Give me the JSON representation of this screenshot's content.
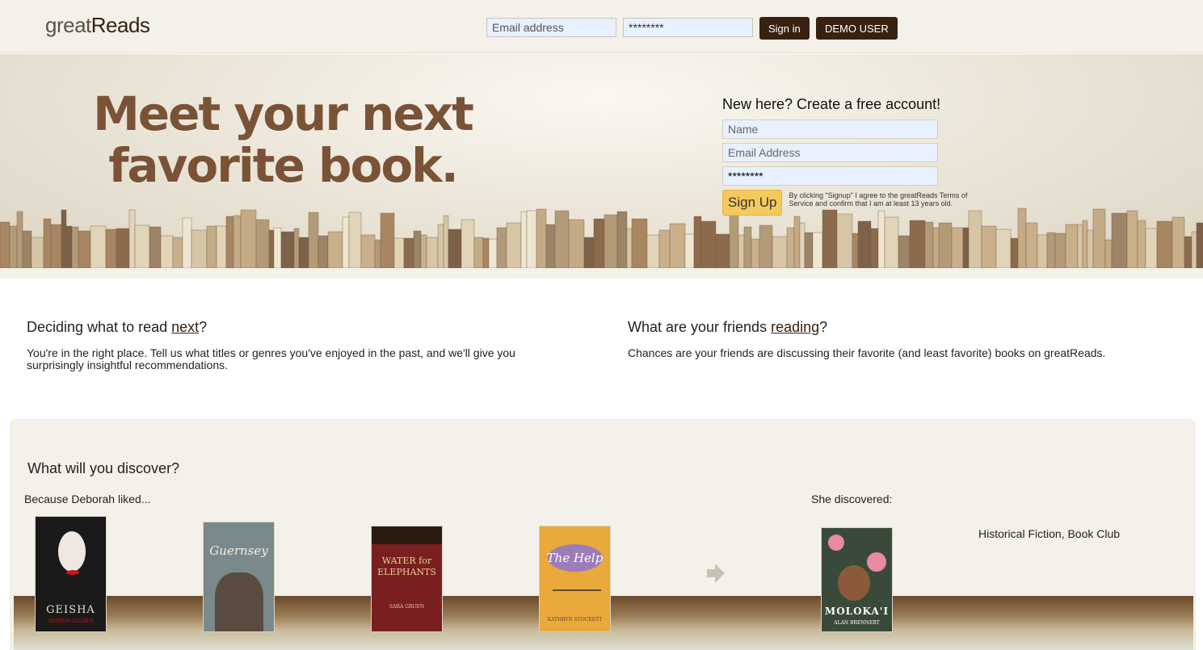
{
  "header": {
    "logo_light": "great",
    "logo_bold": "Reads",
    "email_placeholder": "Email address",
    "password_value": "********",
    "signin_label": "Sign in",
    "demo_label": "DEMO USER"
  },
  "hero": {
    "title_line1": "Meet your next",
    "title_line2": "favorite book.",
    "signup": {
      "heading": "New here? Create a free account!",
      "name_placeholder": "Name",
      "email_placeholder": "Email Address",
      "password_value": "********",
      "button_label": "Sign Up",
      "terms": "By clicking \"Signup\" I agree to the greatReads Terms of Service and confirm that I am at least 13 years old."
    }
  },
  "info": {
    "left": {
      "heading_prefix": "Deciding what to read ",
      "heading_link": "next",
      "heading_suffix": "?",
      "text": "You're in the right place. Tell us what titles or genres you've enjoyed in the past, and we'll give you surprisingly insightful recommendations."
    },
    "right": {
      "heading_prefix": "What are your friends ",
      "heading_link": "reading",
      "heading_suffix": "?",
      "text": "Chances are your friends are discussing their favorite (and least favorite) books on greatReads."
    }
  },
  "discover": {
    "heading": "What will you discover?",
    "because_label": "Because Deborah liked...",
    "discovered_label": "She discovered:",
    "genres": "Historical Fiction, Book Club",
    "liked_books": [
      {
        "title": "GEISHA",
        "author": "ARTHUR GOLDEN",
        "color": "#1a1a1a"
      },
      {
        "title": "Guernsey",
        "author": "",
        "color": "#7a8a8c"
      },
      {
        "title": "WATER for ELEPHANTS",
        "author": "SARA GRUEN",
        "color": "#7a1f1f"
      },
      {
        "title": "The Help",
        "author": "KATHRYN STOCKETT",
        "color": "#e9a93b"
      }
    ],
    "discovered_book": {
      "title": "MOLOKA'I",
      "author": "ALAN BRENNERT",
      "color": "#3a4a3a"
    }
  }
}
